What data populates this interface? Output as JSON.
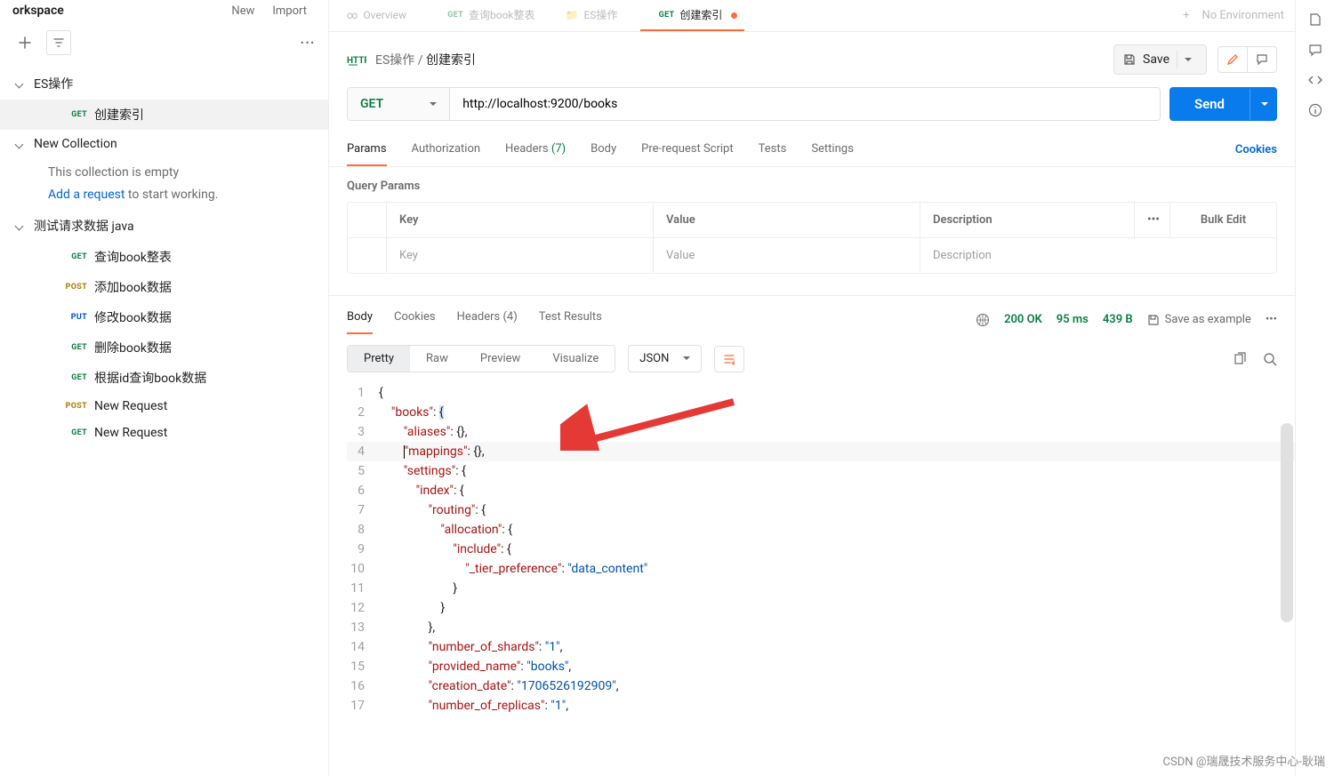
{
  "sidebar": {
    "workspace": "orkspace",
    "new_label": "New",
    "import_label": "Import",
    "collections": [
      {
        "name": "ES操作",
        "items": [
          {
            "method": "GET",
            "name": "创建索引"
          }
        ]
      },
      {
        "name": "New Collection",
        "empty_text": "This collection is empty",
        "add_link": "Add a request",
        "add_suffix": "  to start working."
      },
      {
        "name": "测试请求数据 java",
        "items": [
          {
            "method": "GET",
            "name": "查询book整表"
          },
          {
            "method": "POST",
            "name": "添加book数据"
          },
          {
            "method": "PUT",
            "name": "修改book数据"
          },
          {
            "method": "GET",
            "name": "删除book数据"
          },
          {
            "method": "GET",
            "name": "根据id查询book数据"
          },
          {
            "method": "POST",
            "name": "New Request"
          },
          {
            "method": "GET",
            "name": "New Request"
          }
        ]
      }
    ]
  },
  "tabs": {
    "items": [
      {
        "label": "Overview"
      },
      {
        "method": "GET",
        "label": "查询book整表"
      },
      {
        "label": "ES操作"
      },
      {
        "method": "GET",
        "label": "创建索引"
      }
    ],
    "environment": "No Environment"
  },
  "breadcrumb": {
    "parent": "ES操作",
    "current": "创建索引"
  },
  "actions": {
    "save": "Save",
    "send": "Send"
  },
  "request": {
    "method": "GET",
    "url": "http://localhost:9200/books",
    "tabs": [
      "Params",
      "Authorization",
      "Headers",
      "Body",
      "Pre-request Script",
      "Tests",
      "Settings"
    ],
    "headers_count": "(7)",
    "cookies_link": "Cookies",
    "qp_title": "Query Params",
    "qp_headers": [
      "Key",
      "Value",
      "Description"
    ],
    "qp_placeholders": [
      "Key",
      "Value",
      "Description"
    ],
    "bulk_edit": "Bulk Edit"
  },
  "response": {
    "tabs": [
      "Body",
      "Cookies",
      "Headers",
      "Test Results"
    ],
    "headers_count": "(4)",
    "status": "200 OK",
    "time": "95 ms",
    "size": "439 B",
    "save_example": "Save as example",
    "view_modes": [
      "Pretty",
      "Raw",
      "Preview",
      "Visualize"
    ],
    "format": "JSON",
    "code_lines": [
      {
        "n": 1,
        "indent": 0,
        "tokens": [
          {
            "t": "brace",
            "v": "{"
          }
        ]
      },
      {
        "n": 2,
        "indent": 1,
        "tokens": [
          {
            "t": "prop",
            "v": "\"books\""
          },
          {
            "t": "punc",
            "v": ": "
          },
          {
            "t": "brace",
            "v": "{"
          }
        ],
        "cursor_before_last": true
      },
      {
        "n": 3,
        "indent": 2,
        "tokens": [
          {
            "t": "prop",
            "v": "\"aliases\""
          },
          {
            "t": "punc",
            "v": ": "
          },
          {
            "t": "brace",
            "v": "{}"
          },
          {
            "t": "punc",
            "v": ","
          }
        ]
      },
      {
        "n": 4,
        "indent": 2,
        "hl": true,
        "bar": true,
        "tokens": [
          {
            "t": "prop",
            "v": "\"mappings\""
          },
          {
            "t": "punc",
            "v": ": "
          },
          {
            "t": "brace",
            "v": "{}"
          },
          {
            "t": "punc",
            "v": ","
          }
        ]
      },
      {
        "n": 5,
        "indent": 2,
        "tokens": [
          {
            "t": "prop",
            "v": "\"settings\""
          },
          {
            "t": "punc",
            "v": ": "
          },
          {
            "t": "brace",
            "v": "{"
          }
        ]
      },
      {
        "n": 6,
        "indent": 3,
        "tokens": [
          {
            "t": "prop",
            "v": "\"index\""
          },
          {
            "t": "punc",
            "v": ": "
          },
          {
            "t": "brace",
            "v": "{"
          }
        ]
      },
      {
        "n": 7,
        "indent": 4,
        "tokens": [
          {
            "t": "prop",
            "v": "\"routing\""
          },
          {
            "t": "punc",
            "v": ": "
          },
          {
            "t": "brace",
            "v": "{"
          }
        ]
      },
      {
        "n": 8,
        "indent": 5,
        "tokens": [
          {
            "t": "prop",
            "v": "\"allocation\""
          },
          {
            "t": "punc",
            "v": ": "
          },
          {
            "t": "brace",
            "v": "{"
          }
        ]
      },
      {
        "n": 9,
        "indent": 6,
        "tokens": [
          {
            "t": "prop",
            "v": "\"include\""
          },
          {
            "t": "punc",
            "v": ": "
          },
          {
            "t": "brace",
            "v": "{"
          }
        ]
      },
      {
        "n": 10,
        "indent": 7,
        "tokens": [
          {
            "t": "prop",
            "v": "\"_tier_preference\""
          },
          {
            "t": "punc",
            "v": ": "
          },
          {
            "t": "str",
            "v": "\"data_content\""
          }
        ]
      },
      {
        "n": 11,
        "indent": 6,
        "tokens": [
          {
            "t": "brace",
            "v": "}"
          }
        ]
      },
      {
        "n": 12,
        "indent": 5,
        "tokens": [
          {
            "t": "brace",
            "v": "}"
          }
        ]
      },
      {
        "n": 13,
        "indent": 4,
        "tokens": [
          {
            "t": "brace",
            "v": "}"
          },
          {
            "t": "punc",
            "v": ","
          }
        ]
      },
      {
        "n": 14,
        "indent": 4,
        "tokens": [
          {
            "t": "prop",
            "v": "\"number_of_shards\""
          },
          {
            "t": "punc",
            "v": ": "
          },
          {
            "t": "str",
            "v": "\"1\""
          },
          {
            "t": "punc",
            "v": ","
          }
        ]
      },
      {
        "n": 15,
        "indent": 4,
        "tokens": [
          {
            "t": "prop",
            "v": "\"provided_name\""
          },
          {
            "t": "punc",
            "v": ": "
          },
          {
            "t": "str",
            "v": "\"books\""
          },
          {
            "t": "punc",
            "v": ","
          }
        ]
      },
      {
        "n": 16,
        "indent": 4,
        "tokens": [
          {
            "t": "prop",
            "v": "\"creation_date\""
          },
          {
            "t": "punc",
            "v": ": "
          },
          {
            "t": "str",
            "v": "\"1706526192909\""
          },
          {
            "t": "punc",
            "v": ","
          }
        ]
      },
      {
        "n": 17,
        "indent": 4,
        "tokens": [
          {
            "t": "prop",
            "v": "\"number_of_replicas\""
          },
          {
            "t": "punc",
            "v": ": "
          },
          {
            "t": "str",
            "v": "\"1\""
          },
          {
            "t": "punc",
            "v": ","
          }
        ]
      }
    ]
  },
  "watermark": "CSDN @瑞晟技术服务中心-耿瑞"
}
